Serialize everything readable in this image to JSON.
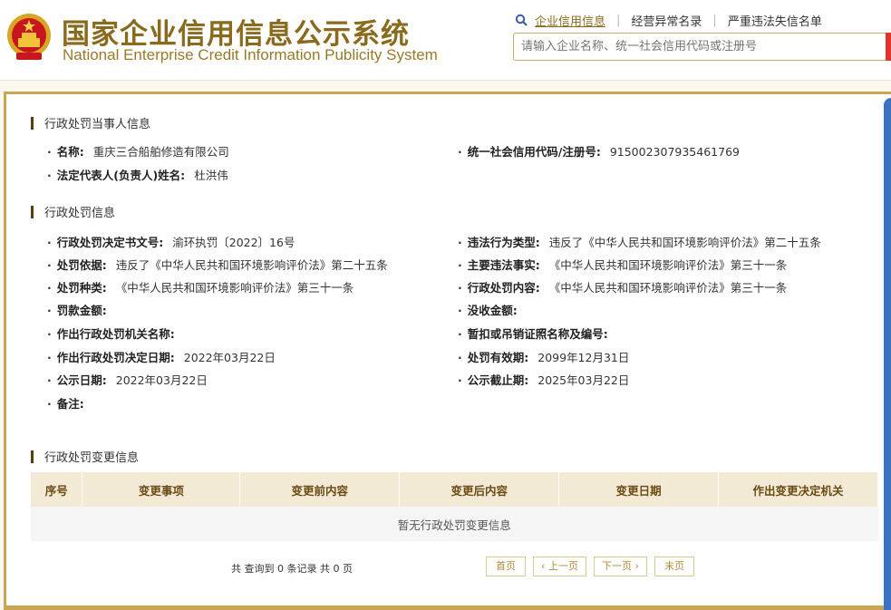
{
  "header": {
    "title_cn": "国家企业信用信息公示系统",
    "title_en": "National Enterprise Credit Information Publicity System",
    "links": [
      "企业信用信息",
      "经营异常名录",
      "严重违法失信名单"
    ],
    "search_placeholder": "请输入企业名称、统一社会信用代码或注册号"
  },
  "party_section": {
    "title": "行政处罚当事人信息",
    "name_label": "名称:",
    "name_value": "重庆三合船舶修造有限公司",
    "credit_code_label": "统一社会信用代码/注册号:",
    "credit_code_value": "915002307935461769",
    "legal_rep_label": "法定代表人(负责人)姓名:",
    "legal_rep_value": "杜洪伟"
  },
  "penalty_section": {
    "title": "行政处罚信息",
    "fields": [
      {
        "label": "行政处罚决定书文号:",
        "value": "渝环执罚〔2022〕16号"
      },
      {
        "label": "违法行为类型:",
        "value": "违反了《中华人民共和国环境影响评价法》第二十五条"
      },
      {
        "label": "处罚依据:",
        "value": "违反了《中华人民共和国环境影响评价法》第二十五条"
      },
      {
        "label": "主要违法事实:",
        "value": "《中华人民共和国环境影响评价法》第三十一条"
      },
      {
        "label": "处罚种类:",
        "value": "《中华人民共和国环境影响评价法》第三十一条"
      },
      {
        "label": "行政处罚内容:",
        "value": "《中华人民共和国环境影响评价法》第三十一条"
      },
      {
        "label": "罚款金额:",
        "value": ""
      },
      {
        "label": "没收金额:",
        "value": ""
      },
      {
        "label": "作出行政处罚机关名称:",
        "value": ""
      },
      {
        "label": "暂扣或吊销证照名称及编号:",
        "value": ""
      },
      {
        "label": "作出行政处罚决定日期:",
        "value": "2022年03月22日"
      },
      {
        "label": "处罚有效期:",
        "value": "2099年12月31日"
      },
      {
        "label": "公示日期:",
        "value": "2022年03月22日"
      },
      {
        "label": "公示截止期:",
        "value": "2025年03月22日"
      },
      {
        "label": "备注:",
        "value": ""
      }
    ]
  },
  "change_section": {
    "title": "行政处罚变更信息",
    "columns": [
      "序号",
      "变更事项",
      "变更前内容",
      "变更后内容",
      "变更日期",
      "作出变更决定机关"
    ],
    "empty_text": "暂无行政处罚变更信息"
  },
  "pager": {
    "info": "共 查询到 0 条记录 共 0 页",
    "first": "首页",
    "prev": "‹ 上一页",
    "next": "下一页 ›",
    "last": "末页"
  },
  "colors": {
    "brand_gold": "#8a6a1d",
    "border_gold": "#c9a554",
    "accent_red": "#e2332d",
    "scroll_blue": "#3b73c4"
  }
}
